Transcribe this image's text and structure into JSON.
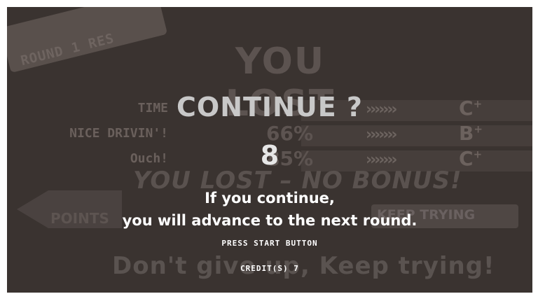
{
  "background": {
    "ribbon_text": "ROUND 1 RES",
    "result_title": "YOU LOST",
    "stats": [
      {
        "label": "TIME",
        "value": "",
        "grade": "C",
        "grade_mod": "+"
      },
      {
        "label": "NICE DRIVIN'!",
        "value": "66%",
        "grade": "B",
        "grade_mod": "+"
      },
      {
        "label": "Ouch!",
        "value": "85%",
        "grade": "C",
        "grade_mod": "+"
      }
    ],
    "chevrons": "›››››››",
    "bonus_text": "YOU LOST – NO BONUS!",
    "points_label": "POINTS",
    "keep_trying_label": "KEEP TRYING",
    "footer_text": "Don't give up, Keep trying!"
  },
  "overlay": {
    "title": "CONTINUE ?",
    "countdown": "8",
    "message_line1": "If you continue,",
    "message_line2": "you will advance to the next round.",
    "press_start": "PRESS START BUTTON",
    "credits": "CREDIT(S)   7"
  }
}
